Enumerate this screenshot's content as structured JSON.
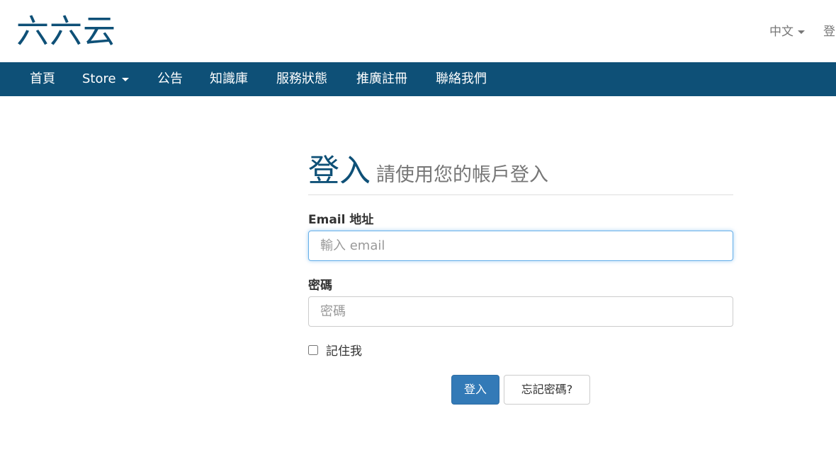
{
  "header": {
    "logo": "六六云",
    "language": "中文",
    "login_link": "登"
  },
  "nav": {
    "items": [
      {
        "label": "首頁"
      },
      {
        "label": "Store"
      },
      {
        "label": "公告"
      },
      {
        "label": "知識庫"
      },
      {
        "label": "服務狀態"
      },
      {
        "label": "推廣註冊"
      },
      {
        "label": "聯絡我們"
      }
    ]
  },
  "login": {
    "title": "登入",
    "subtitle": "請使用您的帳戶登入",
    "email_label": "Email 地址",
    "email_placeholder": "輸入 email",
    "password_label": "密碼",
    "password_placeholder": "密碼",
    "remember_label": "記住我",
    "submit_label": "登入",
    "forgot_label": "忘記密碼?"
  },
  "colors": {
    "brand": "#0e5077",
    "primary_button": "#337ab7"
  }
}
